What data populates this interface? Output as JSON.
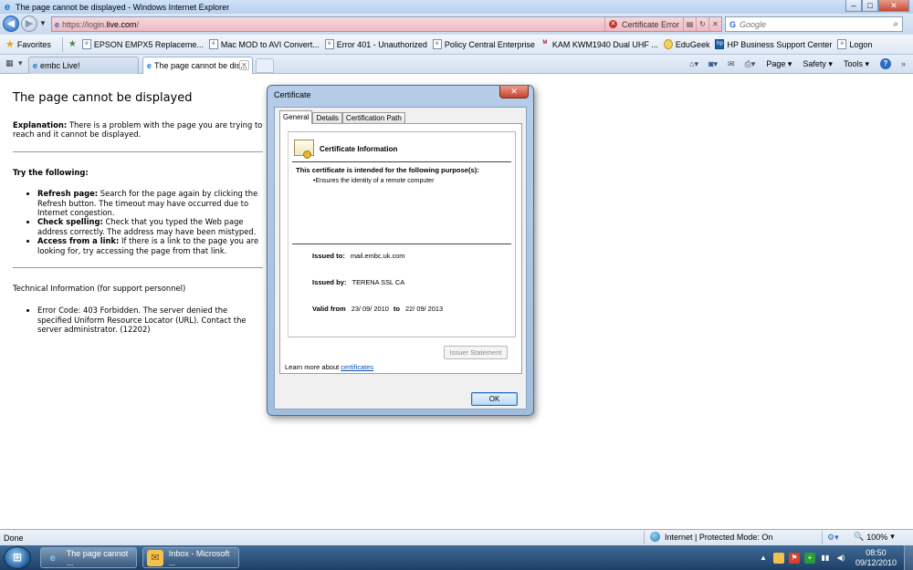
{
  "window": {
    "title": "The page cannot be displayed - Windows Internet Explorer"
  },
  "address_bar": {
    "url_prefix": "https://login.",
    "url_domain": "live.com",
    "url_suffix": "/",
    "cert_error_label": "Certificate Error",
    "search_placeholder": "Google",
    "search_engine_icon": "google-g-icon"
  },
  "favorites_bar": {
    "favorites_label": "Favorites",
    "items": [
      "EPSON EMPX5 Replaceme...",
      "Mac MOD to AVI Convert...",
      "Error 401 - Unauthorized",
      "Policy Central Enterprise",
      "KAM KWM1940 Dual UHF ...",
      "EduGeek",
      "HP Business Support Center",
      "Logon"
    ]
  },
  "tabs": {
    "items": [
      {
        "label": "embc Live!",
        "active": false
      },
      {
        "label": "The page cannot be dis...",
        "active": true
      }
    ]
  },
  "command_bar": {
    "page_label": "Page",
    "safety_label": "Safety",
    "tools_label": "Tools"
  },
  "error_page": {
    "title": "The page cannot be displayed",
    "explanation_label": "Explanation:",
    "explanation_text": " There is a problem with the page you are trying to reach and it cannot be displayed.",
    "try_heading": "Try the following:",
    "tips": [
      {
        "label": "Refresh page:",
        "text": " Search for the page again by clicking the Refresh button. The timeout may have occurred due to Internet congestion."
      },
      {
        "label": "Check spelling:",
        "text": " Check that you typed the Web page address correctly. The address may have been mistyped."
      },
      {
        "label": "Access from a link:",
        "text": " If there is a link to the page you are looking for, try accessing the page from that link."
      }
    ],
    "tech_heading": "Technical Information (for support personnel)",
    "tech_error": "Error Code: 403 Forbidden. The server denied the specified Uniform Resource Locator (URL). Contact the server administrator. (12202)"
  },
  "certificate_dialog": {
    "title": "Certificate",
    "tabs": [
      "General",
      "Details",
      "Certification Path"
    ],
    "info_heading": "Certificate Information",
    "purpose_heading": "This certificate is intended for the following purpose(s):",
    "purpose_items": [
      "Ensures the identity of a remote computer"
    ],
    "issued_to_label": "Issued to:",
    "issued_to_value": "mail.embc.uk.com",
    "issued_by_label": "Issued by:",
    "issued_by_value": "TERENA SSL CA",
    "valid_from_label": "Valid from",
    "valid_from_value": "23/ 09/ 2010",
    "valid_to_label": "to",
    "valid_to_value": "22/ 09/ 2013",
    "issuer_statement_label": "Issuer Statement",
    "learn_more_text": "Learn more about ",
    "learn_more_link": "certificates",
    "ok_label": "OK"
  },
  "status_bar": {
    "left_text": "Done",
    "zone_text": "Internet | Protected Mode: On",
    "zoom": "100%"
  },
  "taskbar": {
    "items": [
      {
        "label": "The page cannot ...",
        "icon": "ie-icon"
      },
      {
        "label": "Inbox - Microsoft ...",
        "icon": "outlook-icon"
      }
    ],
    "clock_time": "08:50",
    "clock_date": "09/12/2010"
  }
}
